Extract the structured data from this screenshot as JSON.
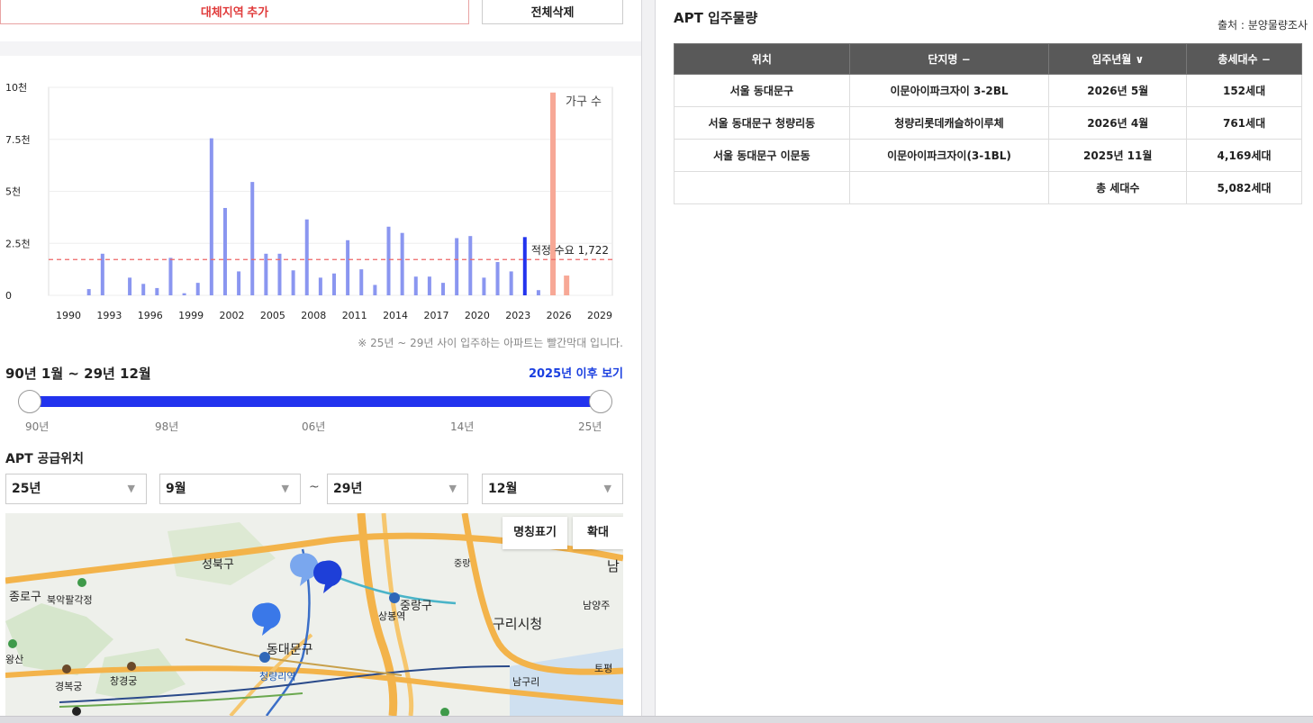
{
  "left": {
    "add_region_label": "대체지역 추가",
    "delete_all_label": "전체삭제",
    "note": "※ 25년 ~ 29년 사이 입주하는 아파트는 빨간막대 입니다.",
    "range_label": "90년 1월 ~ 29년 12월",
    "after_link": "2025년 이후 보기",
    "slider_ticks": [
      "90년",
      "98년",
      "06년",
      "14년",
      "25년"
    ],
    "supply_title": "APT 공급위치",
    "selects": {
      "from_year": "25년",
      "from_month": "9월",
      "tilde": "~",
      "to_year": "29년",
      "to_month": "12월"
    },
    "map": {
      "names_btn": "명칭표기",
      "zoom_btn": "확대",
      "labels": [
        "성북구",
        "종로구",
        "북악팔각정",
        "중랑구",
        "상봉역",
        "구리시청",
        "동대문구",
        "청량리역",
        "경복궁",
        "창경궁",
        "남양주",
        "토평",
        "남구리",
        "중랑",
        "왕산",
        "남"
      ]
    }
  },
  "chart_data": {
    "type": "bar",
    "legend": "가구 수",
    "y_ticks": [
      "0",
      "2.5천",
      "5천",
      "7.5천",
      "10천"
    ],
    "ylim": [
      0,
      10000
    ],
    "x_ticks": [
      "1990",
      "1993",
      "1996",
      "1999",
      "2002",
      "2005",
      "2008",
      "2011",
      "2014",
      "2017",
      "2020",
      "2023",
      "2026",
      "2029"
    ],
    "xlim": [
      1990,
      2029
    ],
    "years": [
      1990,
      1991,
      1992,
      1993,
      1994,
      1995,
      1996,
      1997,
      1998,
      1999,
      2000,
      2001,
      2002,
      2003,
      2004,
      2005,
      2006,
      2007,
      2008,
      2009,
      2010,
      2011,
      2012,
      2013,
      2014,
      2015,
      2016,
      2017,
      2018,
      2019,
      2020,
      2021,
      2022,
      2023,
      2024,
      2025,
      2026,
      2027,
      2028
    ],
    "values": [
      0,
      300,
      2000,
      0,
      850,
      550,
      350,
      1800,
      100,
      600,
      7550,
      4200,
      1150,
      5450,
      2000,
      2000,
      1200,
      3650,
      850,
      1050,
      2650,
      1250,
      500,
      3300,
      3000,
      900,
      900,
      600,
      2750,
      2850,
      850,
      1600,
      1150,
      2800,
      250,
      9750,
      950,
      0,
      0
    ],
    "highlight_year": 2023,
    "future_from": 2025,
    "reference": {
      "value": 1722,
      "label": "적정 수요 1,722"
    },
    "colors": {
      "past": "#8a96f0",
      "highlight": "#2233ee",
      "future": "#f7a896",
      "reference": "#ee6666"
    }
  },
  "right": {
    "title": "APT 입주물량",
    "source": "출처 : 분양물량조사",
    "headers": [
      "위치",
      "단지명 −",
      "입주년월 ∨",
      "총세대수 −"
    ],
    "rows": [
      [
        "서울 동대문구",
        "이문아이파크자이 3-2BL",
        "2026년 5월",
        "152세대"
      ],
      [
        "서울 동대문구 청량리동",
        "청량리롯데캐슬하이루체",
        "2026년 4월",
        "761세대"
      ],
      [
        "서울 동대문구 이문동",
        "이문아이파크자이(3-1BL)",
        "2025년 11월",
        "4,169세대"
      ],
      [
        "",
        "",
        "총 세대수",
        "5,082세대"
      ]
    ]
  }
}
